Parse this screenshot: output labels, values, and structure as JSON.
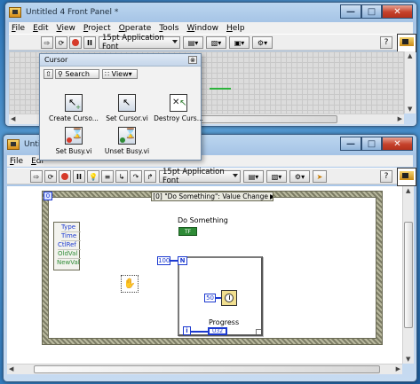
{
  "front_panel": {
    "title": "Untitled 4 Front Panel *",
    "menu": [
      {
        "u": "F",
        "rest": "ile"
      },
      {
        "u": "E",
        "rest": "dit"
      },
      {
        "u": "V",
        "rest": "iew"
      },
      {
        "u": "P",
        "rest": "roject"
      },
      {
        "u": "O",
        "rest": "perate"
      },
      {
        "u": "T",
        "rest": "ools"
      },
      {
        "u": "W",
        "rest": "indow"
      },
      {
        "u": "H",
        "rest": "elp"
      }
    ],
    "font_select": "15pt Application Font",
    "help_glyph": "?"
  },
  "cursor_palette": {
    "title": "Cursor",
    "search_label": "Search",
    "view_label": "View",
    "up_glyph": "⇧",
    "items": [
      {
        "label": "Create Curso...",
        "icon": "create-cursor-icon"
      },
      {
        "label": "Set Cursor.vi",
        "icon": "set-cursor-icon"
      },
      {
        "label": "Destroy Curs...",
        "icon": "destroy-cursor-icon"
      },
      {
        "label": "Set Busy.vi",
        "icon": "set-busy-icon"
      },
      {
        "label": "Unset Busy.vi",
        "icon": "unset-busy-icon"
      }
    ]
  },
  "block_diagram": {
    "title": "Untitled 4 Block Diagram *",
    "title_visible": "Untitle",
    "menu": [
      {
        "u": "F",
        "rest": "ile"
      },
      {
        "u": "E",
        "rest": "di"
      }
    ],
    "font_select": "15pt Application Font",
    "help_glyph": "?",
    "event_structure": {
      "selector_label": "[0] \"Do Something\": Value Change",
      "index_label": "0",
      "event_data": [
        "Type",
        "Time",
        "CtlRef",
        "OldVal",
        "NewVal"
      ]
    },
    "do_something_label": "Do Something",
    "do_something_terminal": "TF",
    "loop_count_constant": "100",
    "loop_count_terminal": "N",
    "wait_constant": "50",
    "iteration_terminal": "i",
    "progress_label": "Progress",
    "progress_terminal": "U32",
    "pointer_icon": "hand-icon"
  },
  "colors": {
    "desktop": "#3c86c8",
    "blue_wire": "#1c3ad0",
    "green_terminal": "#2e8b36",
    "event_frame": "#8f8f74"
  }
}
